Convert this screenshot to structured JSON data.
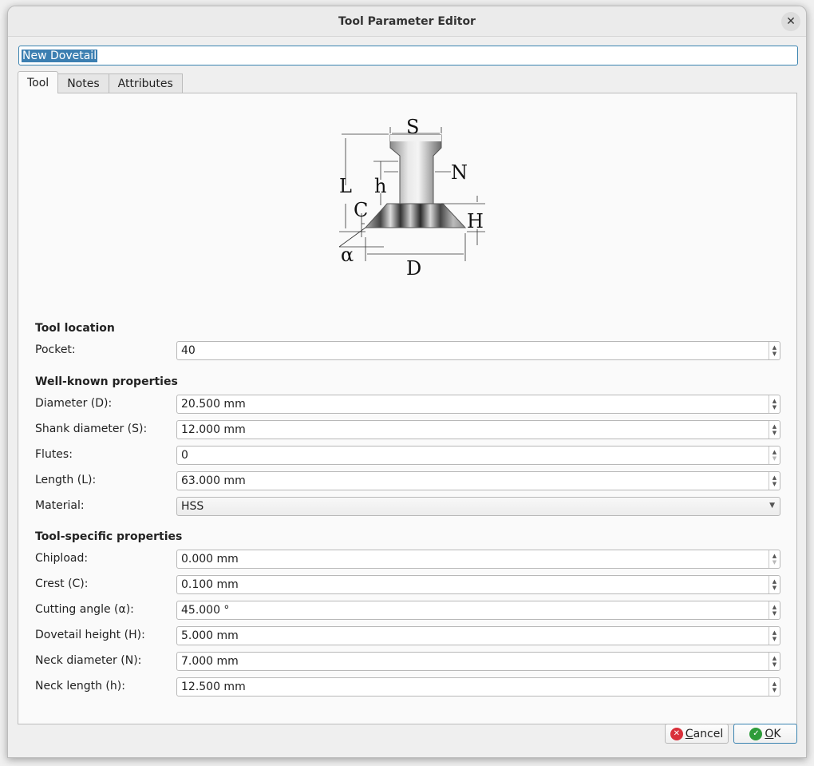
{
  "window": {
    "title": "Tool Parameter Editor",
    "close_icon": "close-icon"
  },
  "tool_name": "New Dovetail",
  "tabs": [
    {
      "label": "Tool",
      "active": true
    },
    {
      "label": "Notes",
      "active": false
    },
    {
      "label": "Attributes",
      "active": false
    }
  ],
  "diagram": {
    "labels": {
      "S": "S",
      "N": "N",
      "L": "L",
      "h": "h",
      "C": "C",
      "H": "H",
      "alpha": "α",
      "D": "D"
    }
  },
  "sections": {
    "tool_location": {
      "title": "Tool location",
      "fields": [
        {
          "label": "Pocket:",
          "value": "40",
          "type": "spin",
          "down_enabled": true
        }
      ]
    },
    "well_known": {
      "title": "Well-known properties",
      "fields": [
        {
          "label": "Diameter (D):",
          "value": "20.500 mm",
          "type": "spin",
          "down_enabled": true
        },
        {
          "label": "Shank diameter (S):",
          "value": "12.000 mm",
          "type": "spin",
          "down_enabled": true
        },
        {
          "label": "Flutes:",
          "value": "0",
          "type": "spin",
          "down_enabled": false
        },
        {
          "label": "Length (L):",
          "value": "63.000 mm",
          "type": "spin",
          "down_enabled": true
        },
        {
          "label": "Material:",
          "value": "HSS",
          "type": "combo"
        }
      ]
    },
    "tool_specific": {
      "title": "Tool-specific properties",
      "fields": [
        {
          "label": "Chipload:",
          "value": "0.000 mm",
          "type": "spin",
          "down_enabled": false
        },
        {
          "label": "Crest (C):",
          "value": "0.100 mm",
          "type": "spin",
          "down_enabled": true
        },
        {
          "label": "Cutting angle (α):",
          "value": "45.000 °",
          "type": "spin",
          "down_enabled": true
        },
        {
          "label": "Dovetail height (H):",
          "value": "5.000 mm",
          "type": "spin",
          "down_enabled": true
        },
        {
          "label": "Neck diameter (N):",
          "value": "7.000 mm",
          "type": "spin",
          "down_enabled": true
        },
        {
          "label": "Neck length (h):",
          "value": "12.500 mm",
          "type": "spin",
          "down_enabled": true
        }
      ]
    }
  },
  "buttons": {
    "cancel": {
      "label_first": "C",
      "label_rest": "ancel",
      "icon": "cancel-icon",
      "color": "#d9303a"
    },
    "ok": {
      "label_first": "O",
      "label_rest": "K",
      "icon": "check-icon",
      "color": "#2e9c3a"
    }
  }
}
